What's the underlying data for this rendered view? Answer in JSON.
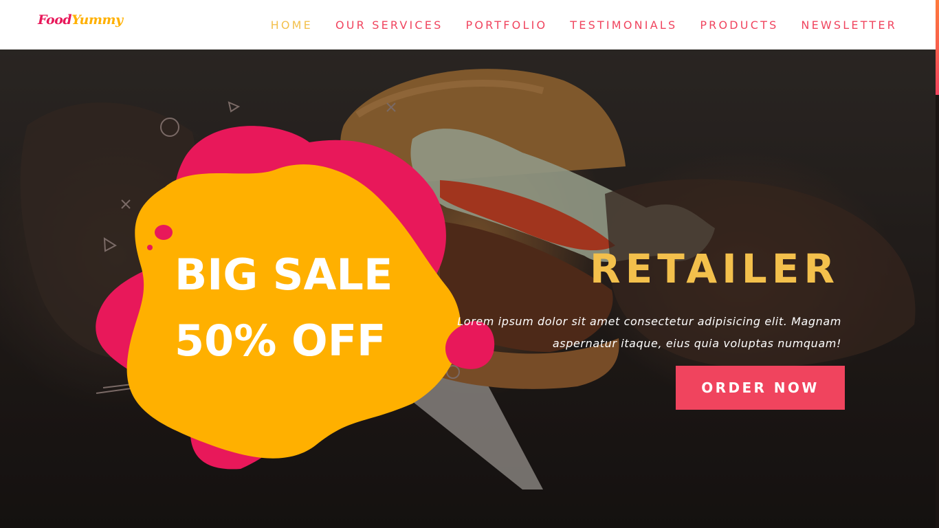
{
  "brand": {
    "logo_part1": "Food",
    "logo_part2": "Yummy"
  },
  "nav": {
    "items": [
      "HOME",
      "OUR SERVICES",
      "PORTFOLIO",
      "TESTIMONIALS",
      "PRODUCTS",
      "NEWSLETTER"
    ],
    "active": "HOME"
  },
  "hero": {
    "sale_line1": "BIG SALE",
    "sale_line2": "50% OFF",
    "title": "RETAILER",
    "description_line1": "Lorem ipsum dolor sit amet consectetur adipisicing elit. Magnam",
    "description_line2": "aspernatur itaque, eius quia voluptas numquam!",
    "cta_label": "ORDER NOW"
  },
  "colors": {
    "nav_text": "#f0445e",
    "nav_active": "#f3c04c",
    "blob_yellow": "#ffb000",
    "blob_pink": "#e8185a",
    "cta_bg": "#f0445e",
    "title_yellow": "#f3c04c"
  }
}
